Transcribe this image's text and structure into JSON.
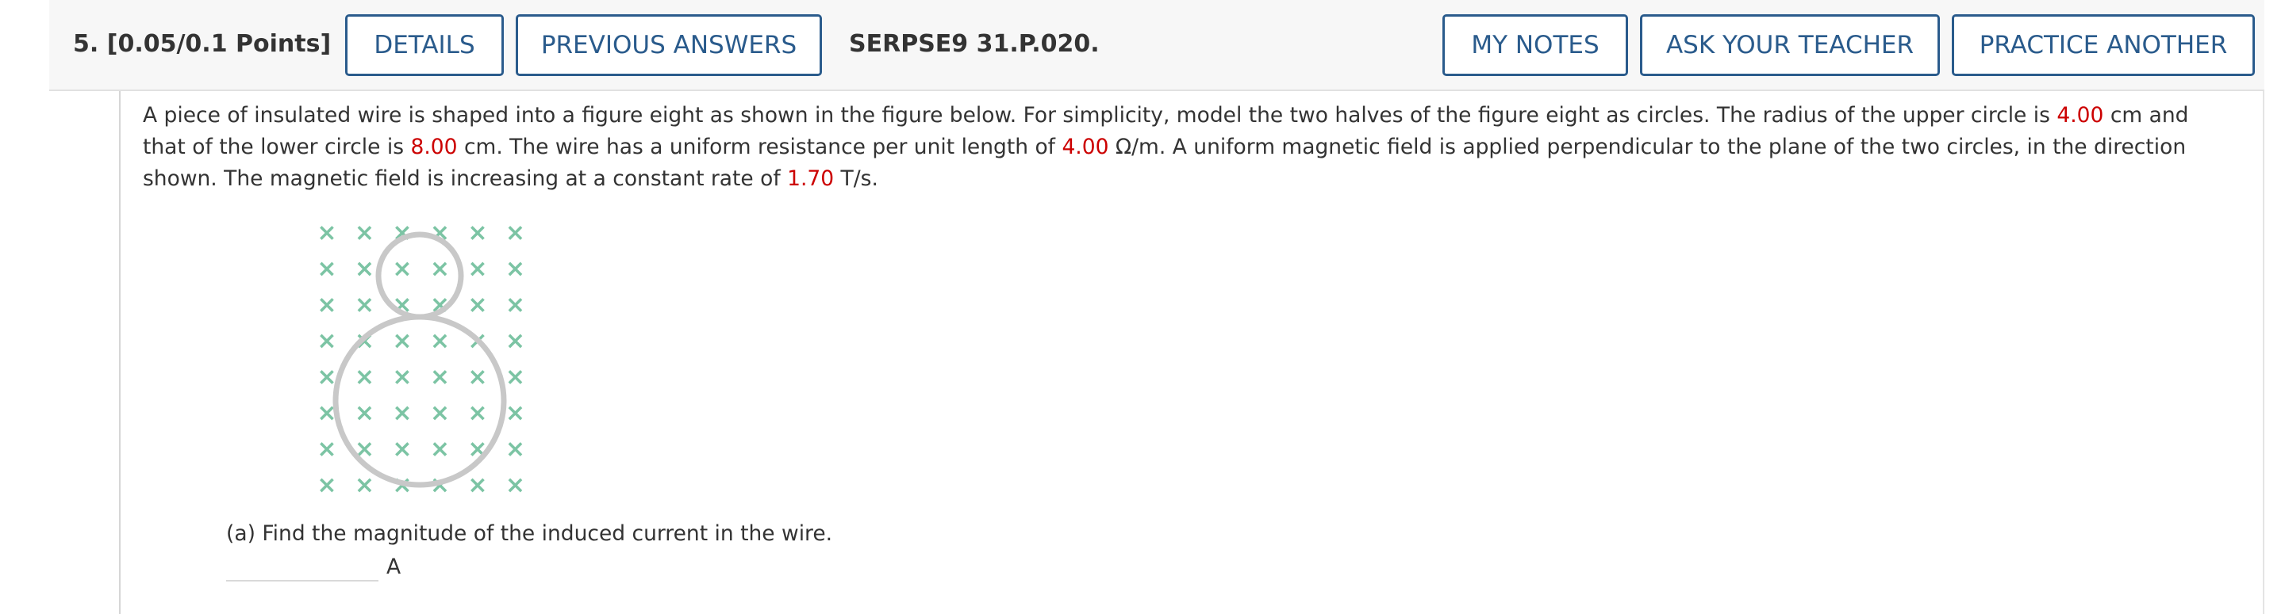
{
  "header": {
    "question_number": "5.",
    "points": "[0.05/0.1 Points]",
    "details_label": "DETAILS",
    "previous_answers_label": "PREVIOUS ANSWERS",
    "problem_code": "SERPSE9 31.P.020.",
    "my_notes_label": "MY NOTES",
    "ask_teacher_label": "ASK YOUR TEACHER",
    "practice_another_label": "PRACTICE ANOTHER"
  },
  "problem": {
    "text_1": "A piece of insulated wire is shaped into a figure eight as shown in the figure below. For simplicity, model the two halves of the figure eight as circles. The radius of the upper circle is ",
    "upper_radius": "4.00",
    "text_2": " cm and that of the lower circle is ",
    "lower_radius": "8.00",
    "text_3": " cm. The wire has a uniform resistance per unit length of ",
    "resistance": "4.00",
    "text_4": " Ω/m. A uniform magnetic field is applied perpendicular to the plane of the two circles, in the direction shown. The magnetic field is increasing at a constant rate of ",
    "rate": "1.70",
    "text_5": " T/s."
  },
  "figure": {
    "field_symbol": "×",
    "field_color": "#7cc4a4",
    "wire_color": "#c8c8c8"
  },
  "part_a": {
    "question": "(a) Find the magnitude of the induced current in the wire.",
    "answer_value": "",
    "unit": "A"
  },
  "colors": {
    "accent": "#2a5b8c",
    "highlight": "#cc0000"
  }
}
